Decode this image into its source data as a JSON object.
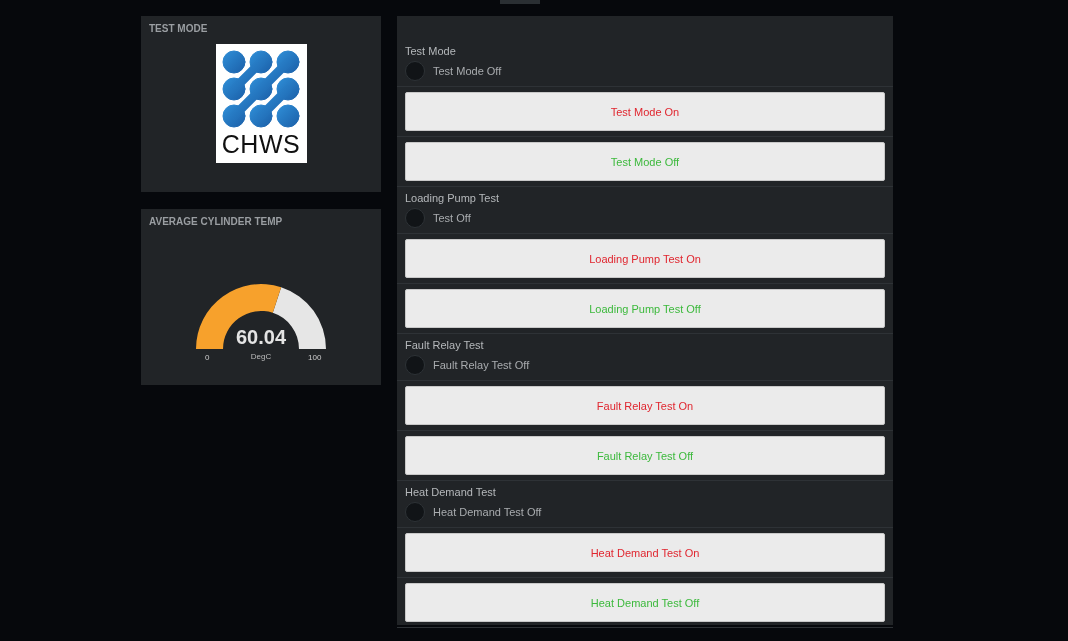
{
  "left_cards": [
    {
      "kind": "logo",
      "title": "TEST MODE",
      "logo_text": "CHWS"
    },
    {
      "kind": "gauge",
      "title": "AVERAGE CYLINDER TEMP",
      "gauge": {
        "level": 0.6004,
        "value": "60.04",
        "unit": "DegC",
        "min": "0",
        "max": "100"
      }
    }
  ],
  "controls": [
    {
      "label": "Test Mode",
      "indicator": {
        "text": "Test Mode Off",
        "on": false
      },
      "buttons": [
        {
          "label": "Test Mode On",
          "kind": "on"
        },
        {
          "label": "Test Mode Off",
          "kind": "off"
        }
      ]
    },
    {
      "label": "Loading Pump Test",
      "indicator": {
        "text": "Test Off",
        "on": false
      },
      "buttons": [
        {
          "label": "Loading Pump Test On",
          "kind": "on"
        },
        {
          "label": "Loading Pump Test Off",
          "kind": "off"
        }
      ]
    },
    {
      "label": "Fault Relay Test",
      "indicator": {
        "text": "Fault Relay Test Off",
        "on": false
      },
      "buttons": [
        {
          "label": "Fault Relay Test On",
          "kind": "on"
        },
        {
          "label": "Fault Relay Test Off",
          "kind": "off"
        }
      ]
    },
    {
      "label": "Heat Demand Test",
      "indicator": {
        "text": "Heat Demand Test Off",
        "on": false
      },
      "buttons": [
        {
          "label": "Heat Demand Test On",
          "kind": "on"
        },
        {
          "label": "Heat Demand Test Off",
          "kind": "off"
        }
      ]
    }
  ]
}
